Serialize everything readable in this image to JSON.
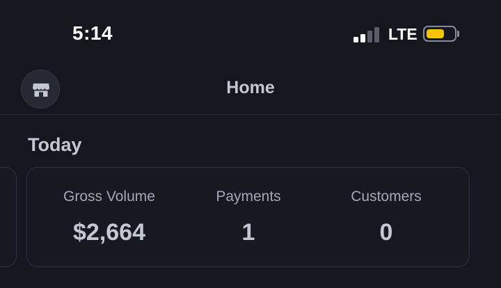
{
  "status_bar": {
    "time": "5:14",
    "network": "LTE",
    "signal_bars_active": 2,
    "signal_bars_total": 4,
    "battery_level": 0.65,
    "battery_color": "#f5c400"
  },
  "nav": {
    "title": "Home",
    "store_icon": "storefront-icon"
  },
  "section": {
    "title": "Today"
  },
  "metrics": [
    {
      "label": "Gross Volume",
      "value": "$2,664"
    },
    {
      "label": "Payments",
      "value": "1"
    },
    {
      "label": "Customers",
      "value": "0"
    }
  ],
  "colors": {
    "background": "#15171e",
    "card_border": "#2f323c",
    "text_primary": "#c3c7d0",
    "text_secondary": "#a4a8b2"
  }
}
